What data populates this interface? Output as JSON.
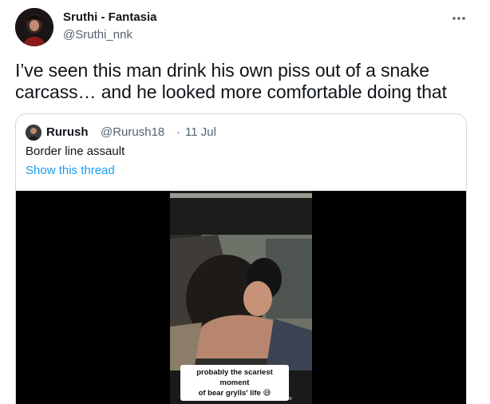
{
  "tweet": {
    "author_name": "Sruthi - Fantasia",
    "author_handle": "@Sruthi_nnk",
    "more_icon": "more-dots-icon",
    "text": "I’ve seen this man drink his own piss out of a snake carcass… and he looked more comfortable doing that"
  },
  "quote": {
    "author_name": "Rurush",
    "author_handle": "@Rurush18",
    "separator": "·",
    "date": "11 Jul",
    "text": "Border line assault",
    "show_thread": "Show this thread",
    "video": {
      "caption_line1": "probably the scariest moment",
      "caption_line2": "of bear grylls' life 😅"
    }
  },
  "colors": {
    "text_primary": "#0f1419",
    "text_secondary": "#536471",
    "link": "#1d9bf0",
    "border": "#cfd9de",
    "video_bg": "#000000"
  }
}
